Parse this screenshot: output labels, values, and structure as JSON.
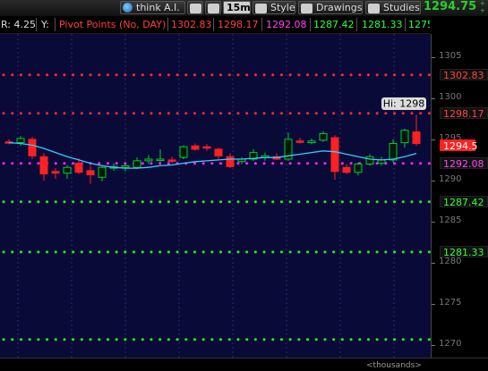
{
  "toolbar": {
    "think_label": "think A.I.",
    "timeframe": "15m",
    "style_label": "Style",
    "drawings_label": "Drawings",
    "studies_label": "Studies",
    "last_price": "1294.75",
    "change_top": "+",
    "change_bottom": "+"
  },
  "studybar": {
    "r_value": "R: 4.25",
    "y_label": "Y:",
    "study_name": "Pivot Points (No, DAY)",
    "values": [
      "1302.83",
      "1298.17",
      "1292.08",
      "1287.42",
      "1281.33",
      "1275..."
    ],
    "colors": [
      "#ff3333",
      "#ff3333",
      "#ff33ff",
      "#33ff33",
      "#33ff33",
      "#33ff33"
    ]
  },
  "axis": {
    "ticks": [
      "1305",
      "1300",
      "1295",
      "1290",
      "1285",
      "1280",
      "1275",
      "1270"
    ],
    "tick_values": [
      1305,
      1300,
      1295,
      1290,
      1285,
      1280,
      1275,
      1270
    ],
    "ylim": [
      1268.5,
      1307.8
    ]
  },
  "pivots": [
    {
      "label": "1302.83",
      "value": 1302.83,
      "color": "#ff2a2a",
      "text": "#ff4040"
    },
    {
      "label": "1298.17",
      "value": 1298.17,
      "color": "#ff2a2a",
      "text": "#ff4040"
    },
    {
      "label": "1292.08",
      "value": 1292.08,
      "color": "#ff22ff",
      "text": "#ff44ff"
    },
    {
      "label": "1287.42",
      "value": 1287.42,
      "color": "#22ee22",
      "text": "#33ff33"
    },
    {
      "label": "1281.33",
      "value": 1281.33,
      "color": "#22ee22",
      "text": "#33ff33"
    },
    {
      "label": "",
      "value": 1270.7,
      "color": "#22ee22",
      "text": "#33ff33"
    }
  ],
  "last_price_label": "1294.5",
  "high_bubble": "Hi: 1298",
  "footer": "<thousands>",
  "colors": {
    "up": "#00cc33",
    "down": "#ff2020",
    "ma": "#33ccff",
    "plot_bg": "#0a0a38",
    "grid": "#2a2a6a"
  },
  "chart_data": {
    "type": "candlestick",
    "ylim": [
      1268.5,
      1307.8
    ],
    "candles": [
      {
        "o": 1294.7,
        "h": 1295.0,
        "l": 1294.4,
        "c": 1294.6
      },
      {
        "o": 1294.6,
        "h": 1295.4,
        "l": 1294.2,
        "c": 1295.1
      },
      {
        "o": 1295.0,
        "h": 1295.3,
        "l": 1292.6,
        "c": 1293.0
      },
      {
        "o": 1292.9,
        "h": 1293.3,
        "l": 1290.0,
        "c": 1290.8
      },
      {
        "o": 1291.1,
        "h": 1291.5,
        "l": 1290.2,
        "c": 1290.9
      },
      {
        "o": 1290.9,
        "h": 1291.9,
        "l": 1290.2,
        "c": 1291.6
      },
      {
        "o": 1292.1,
        "h": 1292.7,
        "l": 1290.8,
        "c": 1291.0
      },
      {
        "o": 1291.2,
        "h": 1291.8,
        "l": 1289.6,
        "c": 1290.7
      },
      {
        "o": 1290.4,
        "h": 1291.7,
        "l": 1289.9,
        "c": 1291.6
      },
      {
        "o": 1291.5,
        "h": 1292.1,
        "l": 1291.2,
        "c": 1291.7
      },
      {
        "o": 1291.6,
        "h": 1292.0,
        "l": 1291.1,
        "c": 1291.8
      },
      {
        "o": 1291.6,
        "h": 1292.8,
        "l": 1291.4,
        "c": 1292.4
      },
      {
        "o": 1292.4,
        "h": 1293.1,
        "l": 1292.0,
        "c": 1292.6
      },
      {
        "o": 1292.5,
        "h": 1293.8,
        "l": 1292.3,
        "c": 1292.6
      },
      {
        "o": 1292.5,
        "h": 1292.9,
        "l": 1292.1,
        "c": 1292.4
      },
      {
        "o": 1292.8,
        "h": 1294.3,
        "l": 1292.6,
        "c": 1294.1
      },
      {
        "o": 1294.2,
        "h": 1294.5,
        "l": 1293.6,
        "c": 1293.8
      },
      {
        "o": 1294.1,
        "h": 1294.4,
        "l": 1293.6,
        "c": 1294.0
      },
      {
        "o": 1293.8,
        "h": 1294.0,
        "l": 1292.6,
        "c": 1293.0
      },
      {
        "o": 1292.9,
        "h": 1293.3,
        "l": 1291.5,
        "c": 1291.7
      },
      {
        "o": 1292.3,
        "h": 1292.8,
        "l": 1292.0,
        "c": 1292.6
      },
      {
        "o": 1292.6,
        "h": 1293.8,
        "l": 1292.4,
        "c": 1293.4
      },
      {
        "o": 1292.8,
        "h": 1293.4,
        "l": 1292.4,
        "c": 1293.0
      },
      {
        "o": 1292.9,
        "h": 1293.3,
        "l": 1292.5,
        "c": 1292.6
      },
      {
        "o": 1292.6,
        "h": 1295.8,
        "l": 1292.4,
        "c": 1295.0
      },
      {
        "o": 1294.8,
        "h": 1295.2,
        "l": 1294.5,
        "c": 1294.7
      },
      {
        "o": 1294.6,
        "h": 1295.1,
        "l": 1294.4,
        "c": 1294.8
      },
      {
        "o": 1294.9,
        "h": 1296.0,
        "l": 1294.7,
        "c": 1295.7
      },
      {
        "o": 1295.2,
        "h": 1295.5,
        "l": 1290.1,
        "c": 1291.1
      },
      {
        "o": 1291.6,
        "h": 1292.0,
        "l": 1290.8,
        "c": 1291.0
      },
      {
        "o": 1291.0,
        "h": 1292.2,
        "l": 1290.6,
        "c": 1292.0
      },
      {
        "o": 1292.0,
        "h": 1293.2,
        "l": 1291.8,
        "c": 1292.9
      },
      {
        "o": 1292.1,
        "h": 1292.9,
        "l": 1291.8,
        "c": 1292.5
      },
      {
        "o": 1292.5,
        "h": 1295.0,
        "l": 1292.2,
        "c": 1294.5
      },
      {
        "o": 1294.6,
        "h": 1296.3,
        "l": 1294.0,
        "c": 1296.1
      },
      {
        "o": 1295.9,
        "h": 1298.0,
        "l": 1294.2,
        "c": 1294.5
      }
    ],
    "ma": [
      1294.6,
      1294.5,
      1294.3,
      1293.9,
      1293.4,
      1292.9,
      1292.5,
      1292.1,
      1291.8,
      1291.6,
      1291.5,
      1291.5,
      1291.6,
      1291.8,
      1291.9,
      1292.1,
      1292.3,
      1292.4,
      1292.5,
      1292.6,
      1292.6,
      1292.7,
      1292.8,
      1292.8,
      1293.0,
      1293.2,
      1293.4,
      1293.6,
      1293.5,
      1293.2,
      1292.9,
      1292.6,
      1292.5,
      1292.6,
      1292.9,
      1293.3
    ]
  }
}
